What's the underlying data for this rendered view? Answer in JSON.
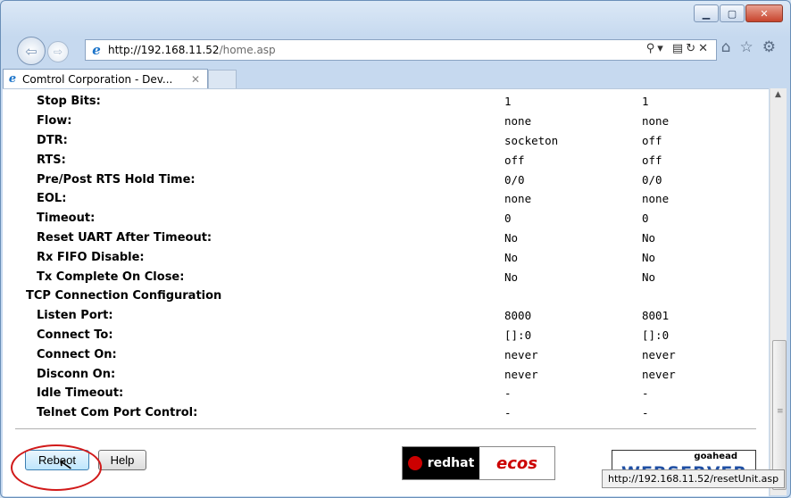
{
  "browser": {
    "address": "http://192.168.11.52/home.asp",
    "address_host": "http://192.168.11.52",
    "address_path": "/home.asp",
    "tab_title": "Comtrol Corporation - Dev...",
    "tab_close": "✕",
    "status_url": "http://192.168.11.52/resetUnit.asp"
  },
  "rows": [
    {
      "label": "Stop Bits:",
      "v1": "1",
      "v2": "1"
    },
    {
      "label": "Flow:",
      "v1": "none",
      "v2": "none"
    },
    {
      "label": "DTR:",
      "v1": "socketon",
      "v2": "off"
    },
    {
      "label": "RTS:",
      "v1": "off",
      "v2": "off"
    },
    {
      "label": "Pre/Post RTS Hold Time:",
      "v1": "0/0",
      "v2": "0/0"
    },
    {
      "label": "EOL:",
      "v1": "none",
      "v2": "none"
    },
    {
      "label": "Timeout:",
      "v1": "0",
      "v2": "0"
    },
    {
      "label": "Reset UART After Timeout:",
      "v1": "No",
      "v2": "No"
    },
    {
      "label": "Rx FIFO Disable:",
      "v1": "No",
      "v2": "No"
    },
    {
      "label": "Tx Complete On Close:",
      "v1": "No",
      "v2": "No"
    }
  ],
  "section_tcp": "TCP Connection Configuration",
  "tcp_rows": [
    {
      "label": "Listen Port:",
      "v1": "8000",
      "v2": "8001"
    },
    {
      "label": "Connect To:",
      "v1": "[]:0",
      "v2": "[]:0"
    },
    {
      "label": "Connect On:",
      "v1": "never",
      "v2": "never"
    },
    {
      "label": "Disconn On:",
      "v1": "never",
      "v2": "never"
    },
    {
      "label": "Idle Timeout:",
      "v1": "-",
      "v2": "-"
    },
    {
      "label": "Telnet Com Port Control:",
      "v1": "-",
      "v2": "-"
    }
  ],
  "buttons": {
    "reboot": "Reboot",
    "help": "Help"
  },
  "logos": {
    "redhat_text": "redhat",
    "ecos_text": "ecos",
    "goahead_small": "goahead",
    "goahead_big": "WEBSERVER"
  }
}
